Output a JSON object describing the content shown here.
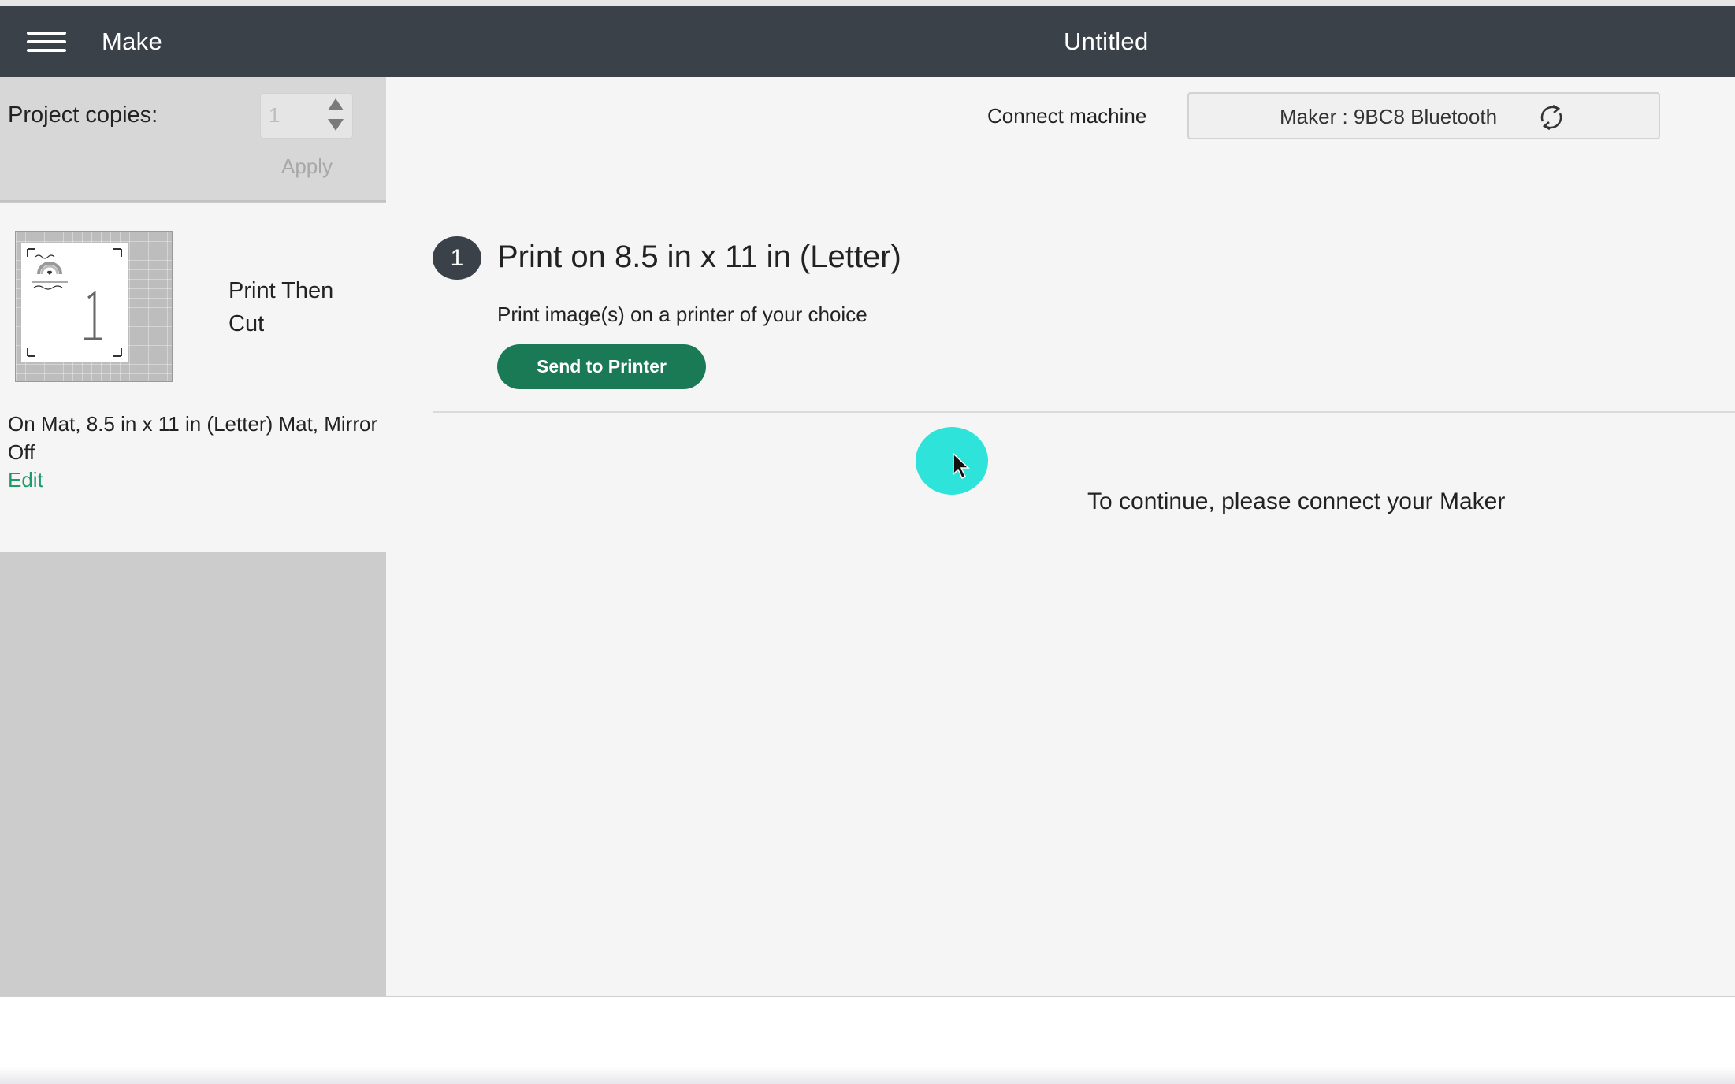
{
  "header": {
    "app_title": "Make",
    "document_title": "Untitled"
  },
  "sidebar": {
    "copies_label": "Project copies:",
    "copies_value": "1",
    "apply_label": "Apply",
    "mat_label": "Print Then Cut",
    "mat_info": "On Mat, 8.5 in x 11 in (Letter) Mat, Mirror Off",
    "edit_label": "Edit",
    "mat_number": "1"
  },
  "main": {
    "connect_label": "Connect machine",
    "machine_value": "Maker : 9BC8 Bluetooth",
    "step_number": "1",
    "step_title": "Print on 8.5 in x 11 in (Letter)",
    "step_description": "Print image(s) on a printer of your choice",
    "send_button_label": "Send to Printer",
    "continue_message": "To continue, please connect your Maker"
  },
  "colors": {
    "header_bg": "#3b4149",
    "accent_green": "#1b7a56",
    "link_green": "#1f9a6a",
    "cursor_halo": "#2de3da"
  },
  "icons": {
    "menu": "hamburger-menu-icon",
    "refresh": "refresh-icon",
    "stepper_up": "arrow-up-icon",
    "stepper_down": "arrow-down-icon",
    "cursor": "mouse-pointer-icon"
  }
}
